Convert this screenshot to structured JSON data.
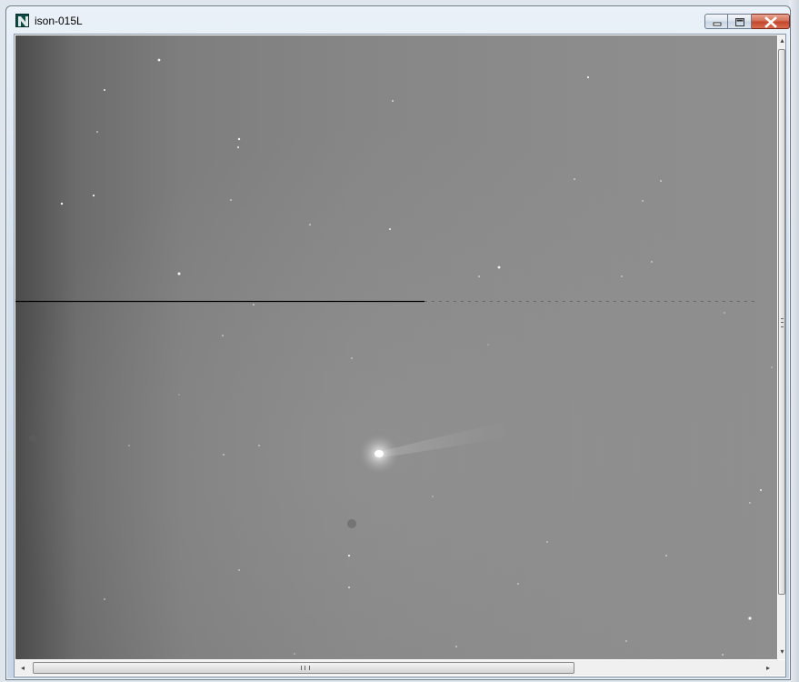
{
  "window": {
    "title": "ison-015L",
    "app_icon": "maxim-dl-icon",
    "controls": [
      "minimize-icon",
      "maximize-icon",
      "close-icon"
    ],
    "close_color": "#c8452c"
  },
  "image": {
    "content": "astronomical-fits-frame",
    "background": "#8a8a8a"
  },
  "scrollbars": {
    "left_arrow": "◂",
    "right_arrow": "▸",
    "up_arrow": "▴",
    "down_arrow": "▾"
  }
}
